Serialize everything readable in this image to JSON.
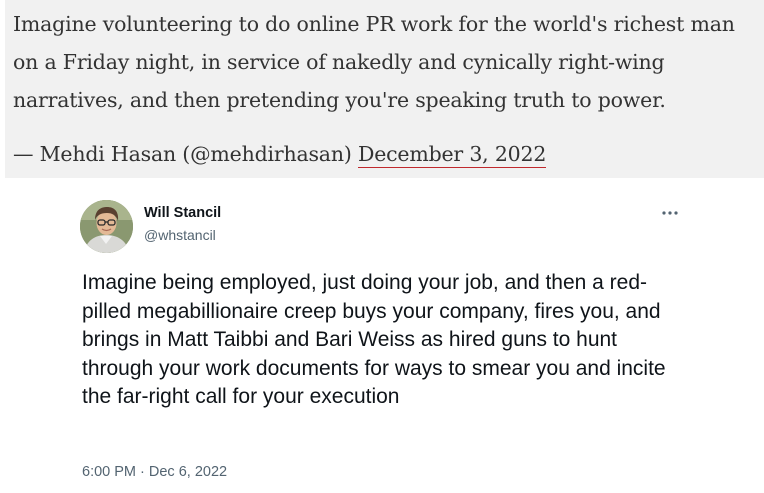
{
  "quote": {
    "text": "Imagine volunteering to do online PR work for the world's richest man on a Friday night, in service of nakedly and cynically right-wing narratives, and then pretending you're speaking truth to power.",
    "attribution": "— Mehdi Hasan (@mehdirhasan)",
    "date": "December 3, 2022",
    "date_underline_color": "#c0292d"
  },
  "tweet": {
    "author_name": "Will Stancil",
    "author_handle": "@whstancil",
    "more_icon": "more-horizontal-icon",
    "body": "Imagine being employed, just doing your job, and then a red-pilled megabillionaire creep buys your company, fires you, and brings in Matt Taibbi and Bari Weiss as hired guns to hunt through your work documents for ways to smear you and incite the far-right call for your execution",
    "timestamp": "6:00 PM · Dec 6, 2022"
  }
}
